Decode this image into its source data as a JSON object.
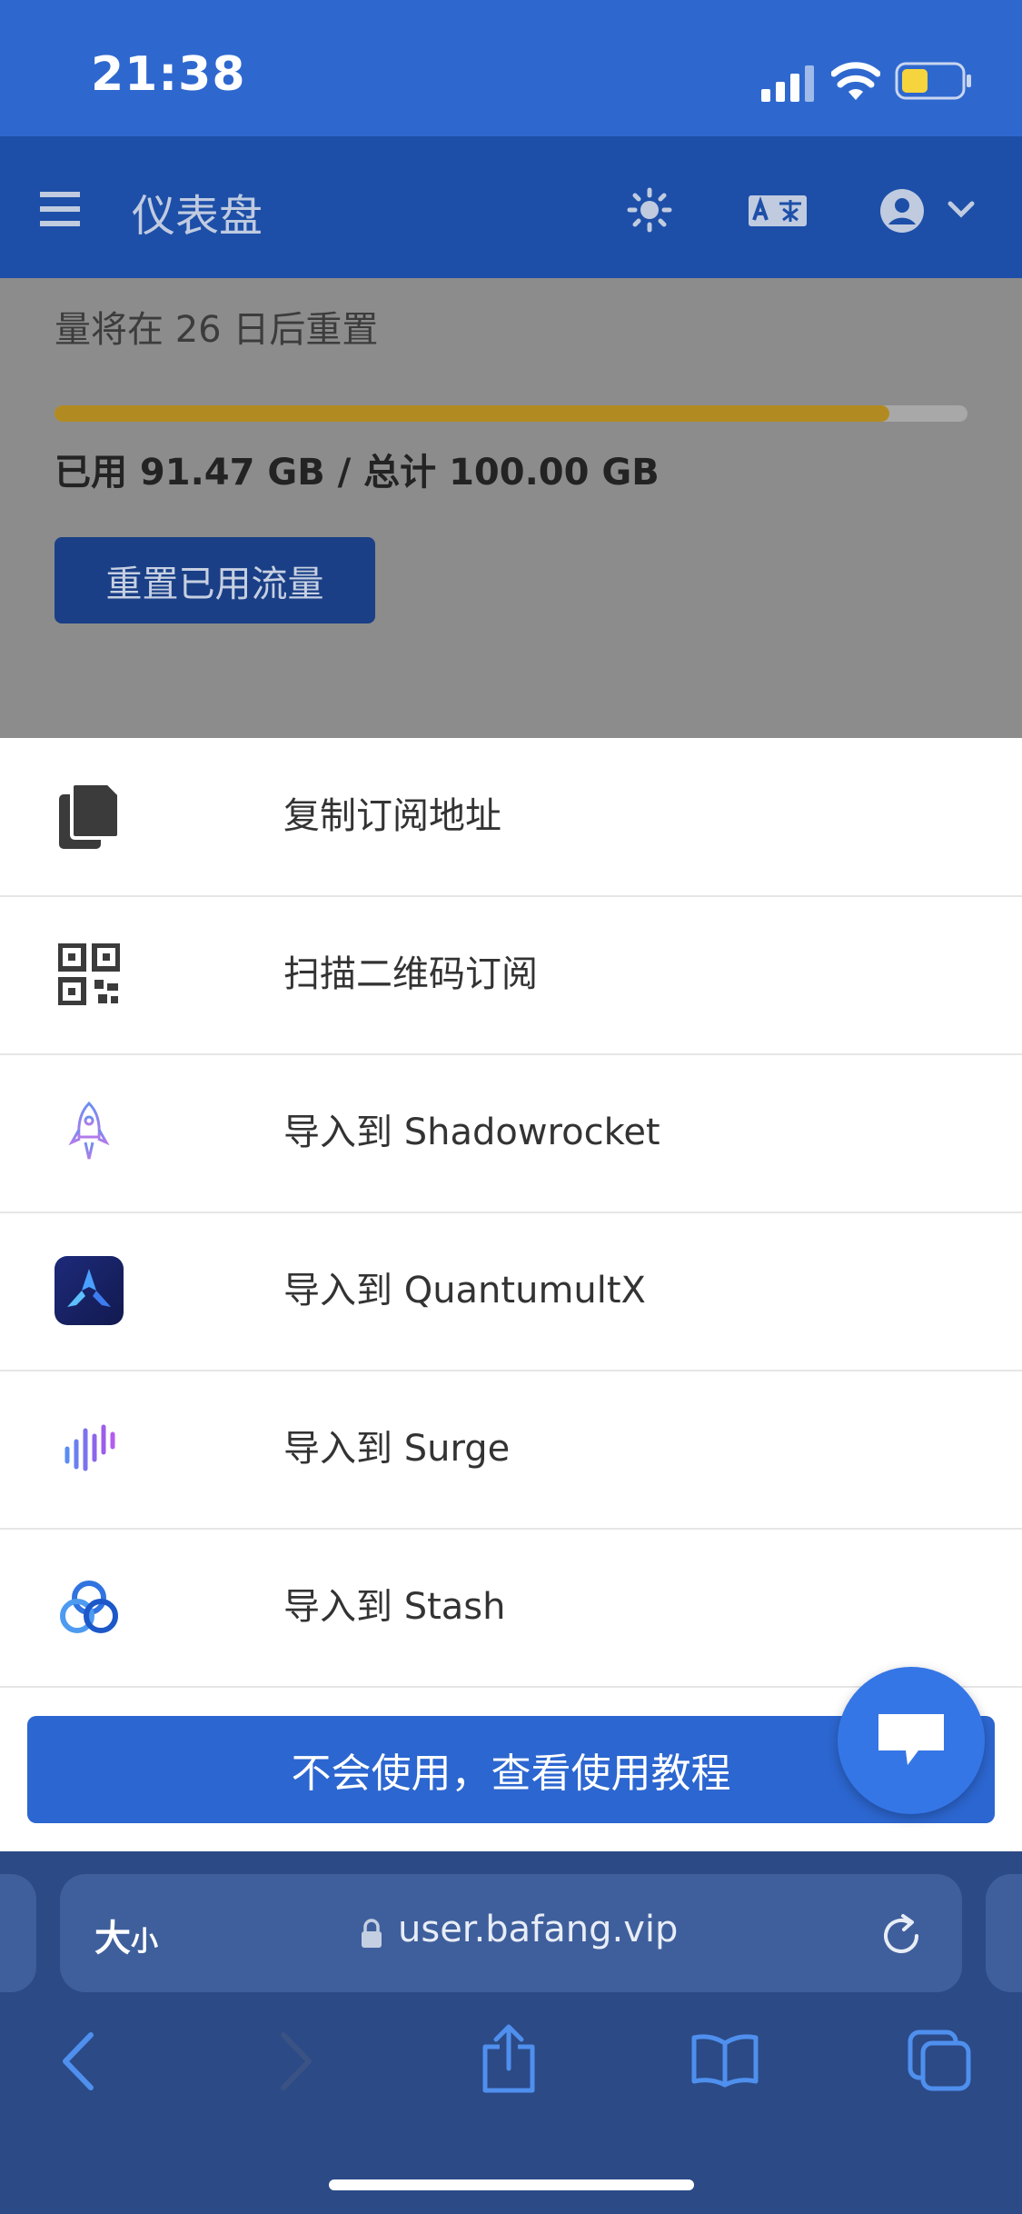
{
  "status_bar": {
    "time": "21:38"
  },
  "navbar": {
    "title": "仪表盘"
  },
  "traffic": {
    "reset_text": "量将在 26 日后重置",
    "used_fraction": 0.9147,
    "usage_text": "已用 91.47 GB / 总计 100.00 GB",
    "reset_button": "重置已用流量"
  },
  "sheet": {
    "items": [
      {
        "label": "复制订阅地址",
        "icon": "copy-icon"
      },
      {
        "label": "扫描二维码订阅",
        "icon": "qrcode-icon"
      },
      {
        "label": "导入到 Shadowrocket",
        "icon": "shadowrocket-icon"
      },
      {
        "label": "导入到 QuantumultX",
        "icon": "quantumultx-icon"
      },
      {
        "label": "导入到 Surge",
        "icon": "surge-icon"
      },
      {
        "label": "导入到 Stash",
        "icon": "stash-icon"
      }
    ],
    "tutorial_button": "不会使用，查看使用教程"
  },
  "browser": {
    "font_size_big": "大",
    "font_size_small": "小",
    "url": "user.bafang.vip"
  },
  "colors": {
    "accent": "#2c66d0",
    "status_bar": "#2e68cf",
    "navbar": "#1d4fa8",
    "progress": "#b18b22"
  }
}
